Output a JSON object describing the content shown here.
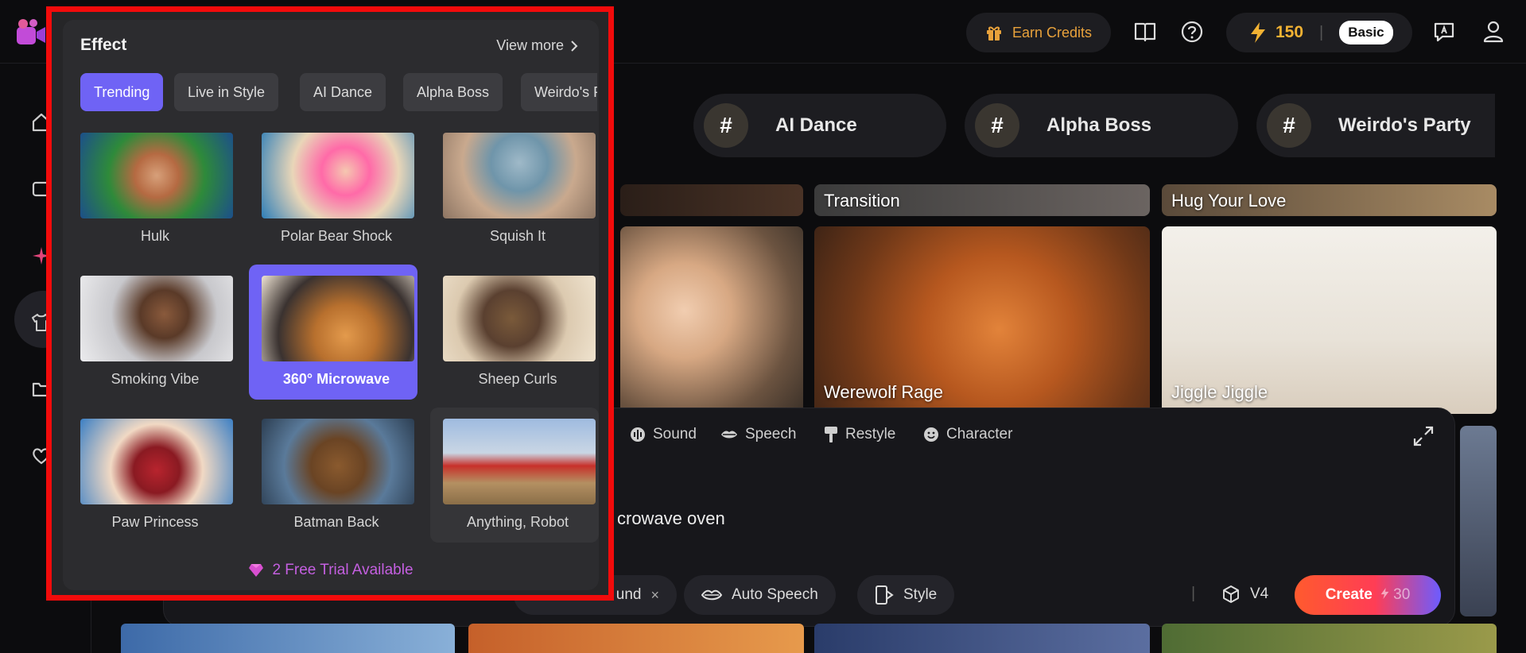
{
  "topbar": {
    "earn_credits": "Earn Credits",
    "credits": "150",
    "plan": "Basic"
  },
  "category_chips": [
    {
      "label": "AI Dance"
    },
    {
      "label": "Alpha Boss"
    },
    {
      "label": "Weirdo's Party"
    }
  ],
  "gallery": [
    {
      "label": "Transition"
    },
    {
      "label": "Hug Your Love"
    },
    {
      "label": "Werewolf Rage"
    },
    {
      "label": "Jiggle Jiggle"
    }
  ],
  "composer": {
    "tabs": [
      "Sound",
      "Speech",
      "Restyle",
      "Character"
    ],
    "prompt_text": "crowave oven",
    "partial_button": "und",
    "auto_speech": "Auto Speech",
    "style": "Style",
    "model": "V4",
    "create": "Create",
    "cost": "30"
  },
  "effect_popup": {
    "title": "Effect",
    "view_more": "View more",
    "tabs": [
      "Trending",
      "Live in Style",
      "AI Dance",
      "Alpha Boss",
      "Weirdo's Part"
    ],
    "active_tab": "Trending",
    "effects": [
      {
        "name": "Hulk"
      },
      {
        "name": "Polar Bear Shock"
      },
      {
        "name": "Squish It"
      },
      {
        "name": "Smoking Vibe"
      },
      {
        "name": "360° Microwave"
      },
      {
        "name": "Sheep Curls"
      },
      {
        "name": "Paw Princess"
      },
      {
        "name": "Batman Back"
      },
      {
        "name": "Anything, Robot"
      }
    ],
    "selected_effect": "360° Microwave",
    "trial_text": "2 Free Trial Available"
  },
  "colors": {
    "accent": "#6f63f5",
    "highlight_border": "#f20b0b",
    "credits_text": "#e9a23b",
    "trial_text": "#c45fe0"
  }
}
